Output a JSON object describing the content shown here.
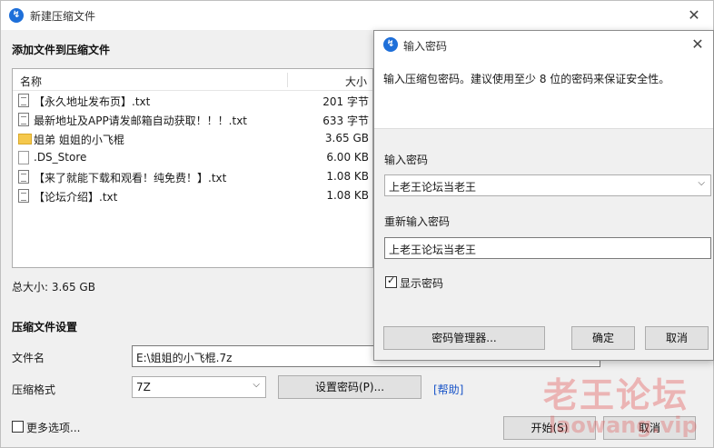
{
  "main": {
    "title": "新建压缩文件",
    "close": "✕",
    "add_section": "添加文件到压缩文件",
    "list": {
      "col_name": "名称",
      "col_size": "大小",
      "rows": [
        {
          "icon": "text-file-icon",
          "name": "【永久地址发布页】.txt",
          "size": "201 字节"
        },
        {
          "icon": "text-file-icon",
          "name": "最新地址及APP请发邮箱自动获取！！！.txt",
          "size": "633 字节"
        },
        {
          "icon": "folder-icon",
          "name": "姐弟 姐姐的小飞棍",
          "size": "3.65 GB"
        },
        {
          "icon": "blank-file-icon",
          "name": ".DS_Store",
          "size": "6.00 KB"
        },
        {
          "icon": "text-file-icon",
          "name": "【来了就能下载和观看！纯免费！】.txt",
          "size": "1.08 KB"
        },
        {
          "icon": "text-file-icon",
          "name": "【论坛介绍】.txt",
          "size": "1.08 KB"
        }
      ]
    },
    "total": "总大小: 3.65 GB",
    "settings_section": "压缩文件设置",
    "filename_label": "文件名",
    "filename_value": "E:\\姐姐的小飞棍.7z",
    "format_label": "压缩格式",
    "format_value": "7Z",
    "set_password_btn": "设置密码(P)...",
    "help_link": "[帮助]",
    "more_options": "更多选项...",
    "start_btn": "开始(S)",
    "cancel_btn": "取消"
  },
  "dialog": {
    "title": "输入密码",
    "close": "✕",
    "message": "输入压缩包密码。建议使用至少 8 位的密码来保证安全性。",
    "enter_label": "输入密码",
    "enter_value": "上老王论坛当老王",
    "reenter_label": "重新输入密码",
    "reenter_value": "上老王论坛当老王",
    "show_password": "显示密码",
    "manager_btn": "密码管理器...",
    "ok_btn": "确定",
    "cancel_btn": "取消"
  },
  "watermark": {
    "line1": "老王论坛",
    "line2": "laowang.vip"
  },
  "colors": {
    "accent": "#1e6fd9",
    "link": "#1a55c8",
    "watermark": "#e14646"
  }
}
